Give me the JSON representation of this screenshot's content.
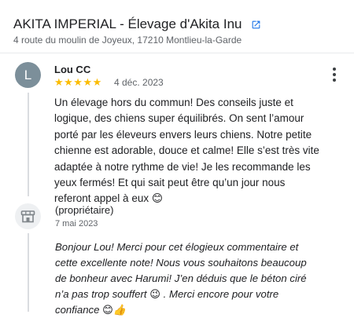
{
  "business": {
    "name": "AKITA IMPERIAL - Élevage d'Akita Inu",
    "address": "4 route du moulin de Joyeux, 17210 Montlieu-la-Garde"
  },
  "review": {
    "avatar_letter": "L",
    "author": "Lou CC",
    "stars": "★★★★★",
    "rating": 5,
    "date": "4 déc. 2023",
    "text": "Un élevage hors du commun! Des conseils juste et\nlogique, des chiens super équilibrés. On sent l’amour\nporté par les éleveurs envers leurs chiens. Notre petite\nchienne est adorable, douce et calme! Elle s’est très vite\nadaptée à notre rythme de vie! Je les recommande les\nyeux fermés! Et qui sait peut être qu’un jour nous\nreferont appel à eux 😊"
  },
  "owner_reply": {
    "label": "(propriétaire)",
    "date": "7 mai 2023",
    "text": "Bonjour Lou! Merci pour cet élogieux commentaire et\ncette excellente note! Nous vous souhaitons beaucoup\nde bonheur avec Harumi! J’en déduis que le béton ciré\nn’a pas trop souffert 😉 . Merci encore pour votre\nconfiance 😊👍"
  },
  "icons": {
    "external_link": "external-link-icon",
    "store": "store-icon",
    "more": "more-vertical-icon"
  },
  "colors": {
    "star": "#fbbc04",
    "link_icon": "#1a73e8",
    "avatar": "#7c8f9a"
  }
}
